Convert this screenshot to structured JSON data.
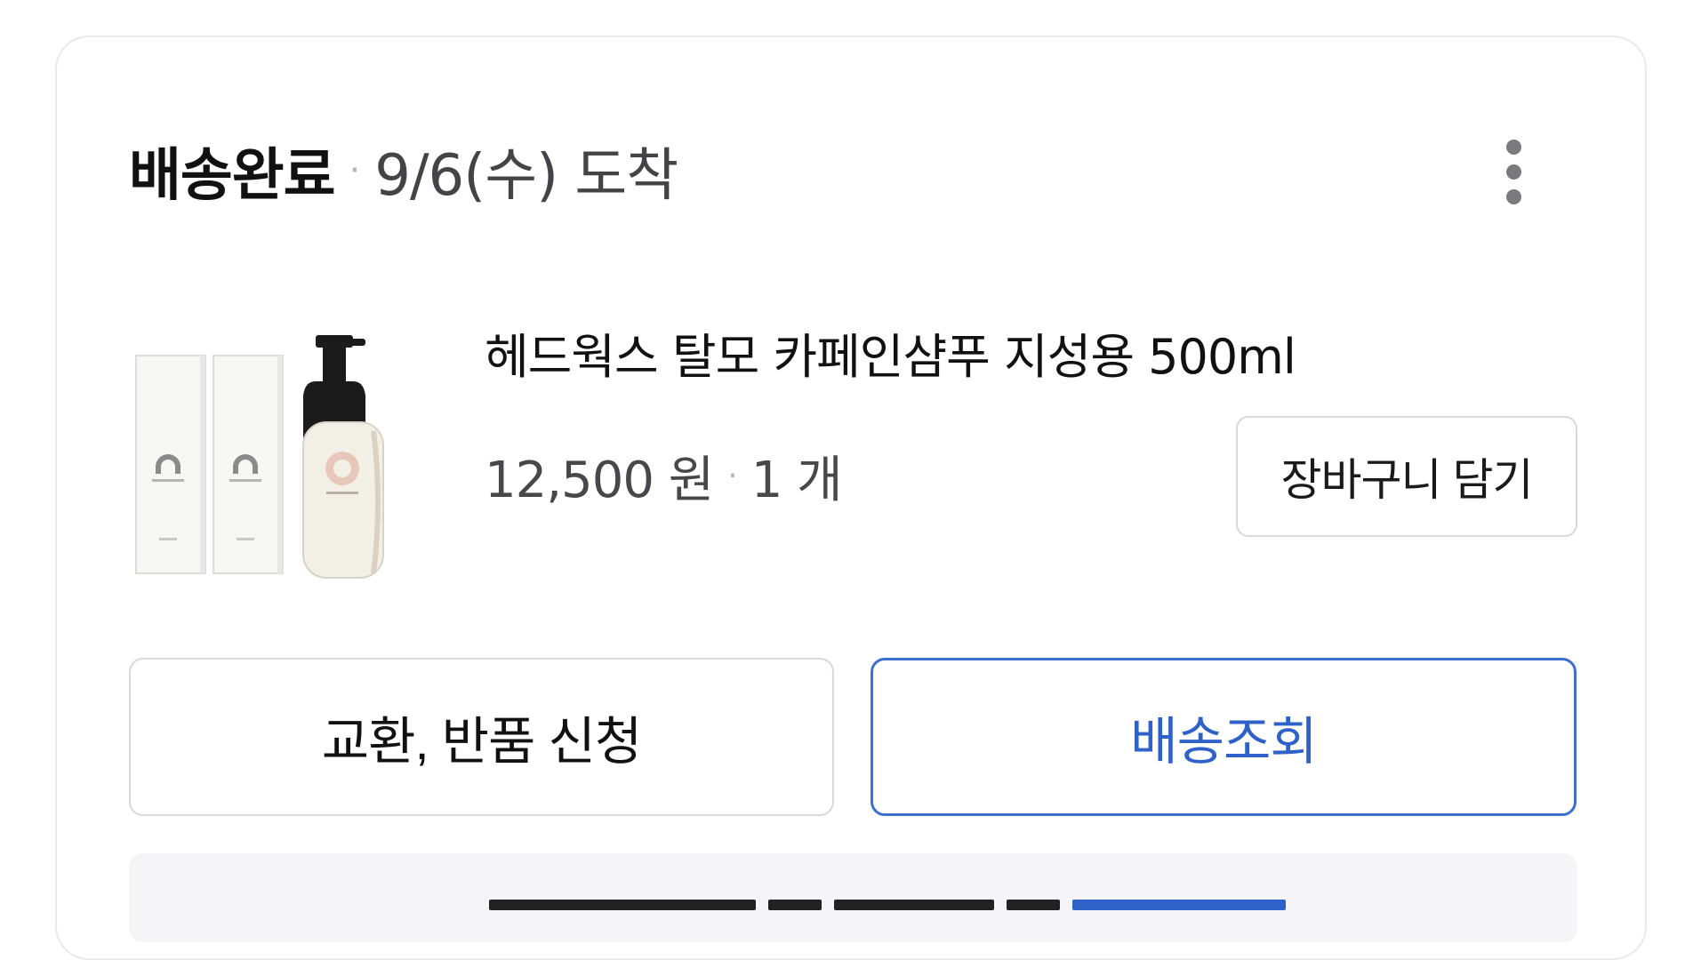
{
  "order": {
    "status": "배송완료",
    "separator": "·",
    "arrival": "9/6(수) 도착"
  },
  "menu": {
    "icon": "more-vertical-icon"
  },
  "product": {
    "name": "헤드웍스 탈모 카페인샴푸 지성용 500ml",
    "price": "12,500 원",
    "separator": "·",
    "quantity": "1 개",
    "image": "product-thumbnail"
  },
  "buttons": {
    "add_to_cart": "장바구니 담기",
    "exchange_return": "교환, 반품 신청",
    "track_delivery": "배송조회"
  },
  "colors": {
    "accent": "#2e62c9",
    "border": "#d9d9dd",
    "muted_text": "#48484c"
  }
}
